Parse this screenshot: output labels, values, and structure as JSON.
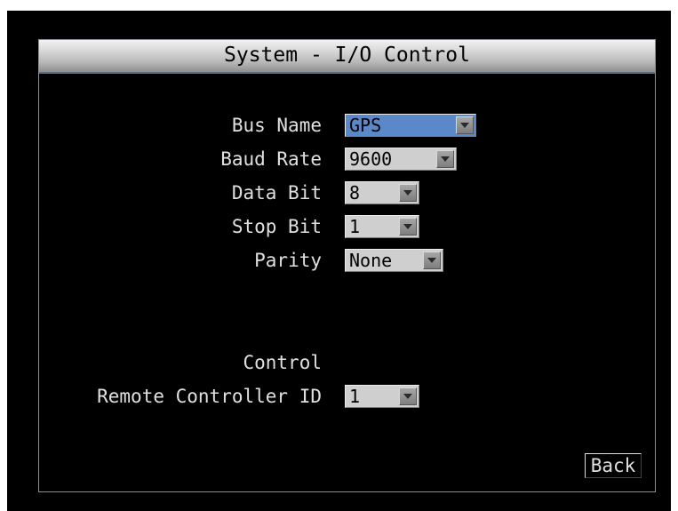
{
  "window": {
    "title": "System - I/O Control"
  },
  "fields": [
    {
      "label": "Bus Name",
      "value": "GPS"
    },
    {
      "label": "Baud Rate",
      "value": "9600"
    },
    {
      "label": "Data Bit",
      "value": "8"
    },
    {
      "label": "Stop Bit",
      "value": "1"
    },
    {
      "label": "Parity",
      "value": "None"
    }
  ],
  "control": {
    "heading": "Control",
    "remote_controller": {
      "label": "Remote Controller ID",
      "value": "1"
    }
  },
  "footer": {
    "back_label": "Back"
  },
  "colors": {
    "background": "#000000",
    "text": "#e0e0e0",
    "selected_field": "#5b88c8",
    "field": "#cfcfcf"
  }
}
